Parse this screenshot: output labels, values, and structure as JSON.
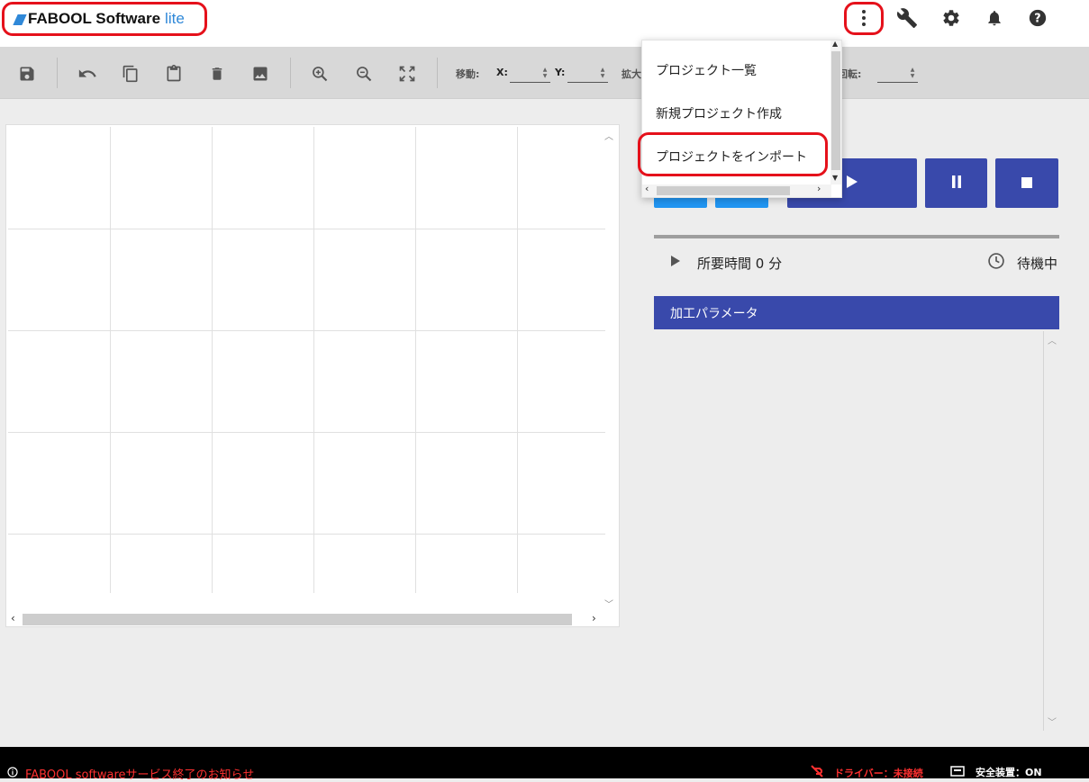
{
  "app": {
    "brand_name": "FABOOL Software",
    "brand_suffix": "lite",
    "brand_accent": "#2f88d8",
    "highlight_color": "#e5111b"
  },
  "header": {
    "icons": [
      "more-vert-icon",
      "wrench-icon",
      "gear-icon",
      "bell-icon",
      "help-icon"
    ]
  },
  "toolbar": {
    "move_label": "移動:",
    "x_label": "X:",
    "y_label": "Y:",
    "scale_label": "拡大",
    "rotate_label": "回転:",
    "x_value": "",
    "y_value": "",
    "rotate_value": ""
  },
  "dropdown": {
    "items": [
      "プロジェクト一覧",
      "新規プロジェクト作成",
      "プロジェクトをインポート"
    ]
  },
  "controls": {
    "accent": "#3949ab",
    "light_accent": "#2196f3"
  },
  "status": {
    "time_text": "所要時間 0 分",
    "state_text": "待機中"
  },
  "params": {
    "header": "加工パラメータ"
  },
  "footer": {
    "notice": "FABOOL softwareサービス終了のお知らせ",
    "driver_status": "ドライバー：未接続",
    "safety_status": "安全装置：ON"
  }
}
